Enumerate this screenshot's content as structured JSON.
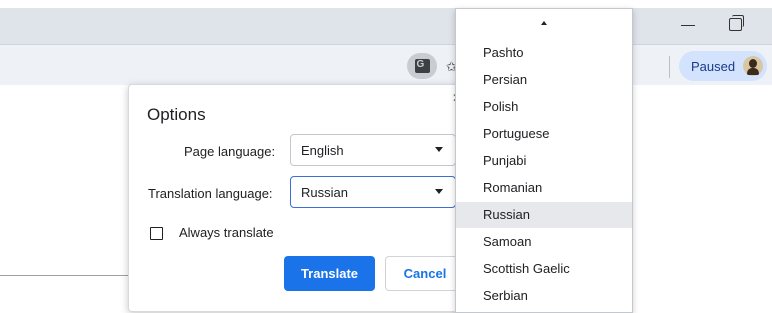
{
  "toolbar": {
    "paused_label": "Paused"
  },
  "icons": {
    "translate": "translate-icon",
    "bookmark": "bookmark-icon",
    "minimize": "minimize-icon",
    "restore": "restore-icon",
    "avatar": "avatar"
  },
  "dialog": {
    "title": "Options",
    "page_language_label": "Page language:",
    "page_language_value": "English",
    "translation_language_label": "Translation language:",
    "translation_language_value": "Russian",
    "always_translate_label": "Always translate",
    "always_translate_checked": false,
    "translate_button": "Translate",
    "cancel_button": "Cancel"
  },
  "dropdown": {
    "options": [
      "Pashto",
      "Persian",
      "Polish",
      "Portuguese",
      "Punjabi",
      "Romanian",
      "Russian",
      "Samoan",
      "Scottish Gaelic",
      "Serbian"
    ],
    "selected": "Russian"
  },
  "colors": {
    "accent": "#1a73e8",
    "chip_background": "#d3e3fd"
  }
}
